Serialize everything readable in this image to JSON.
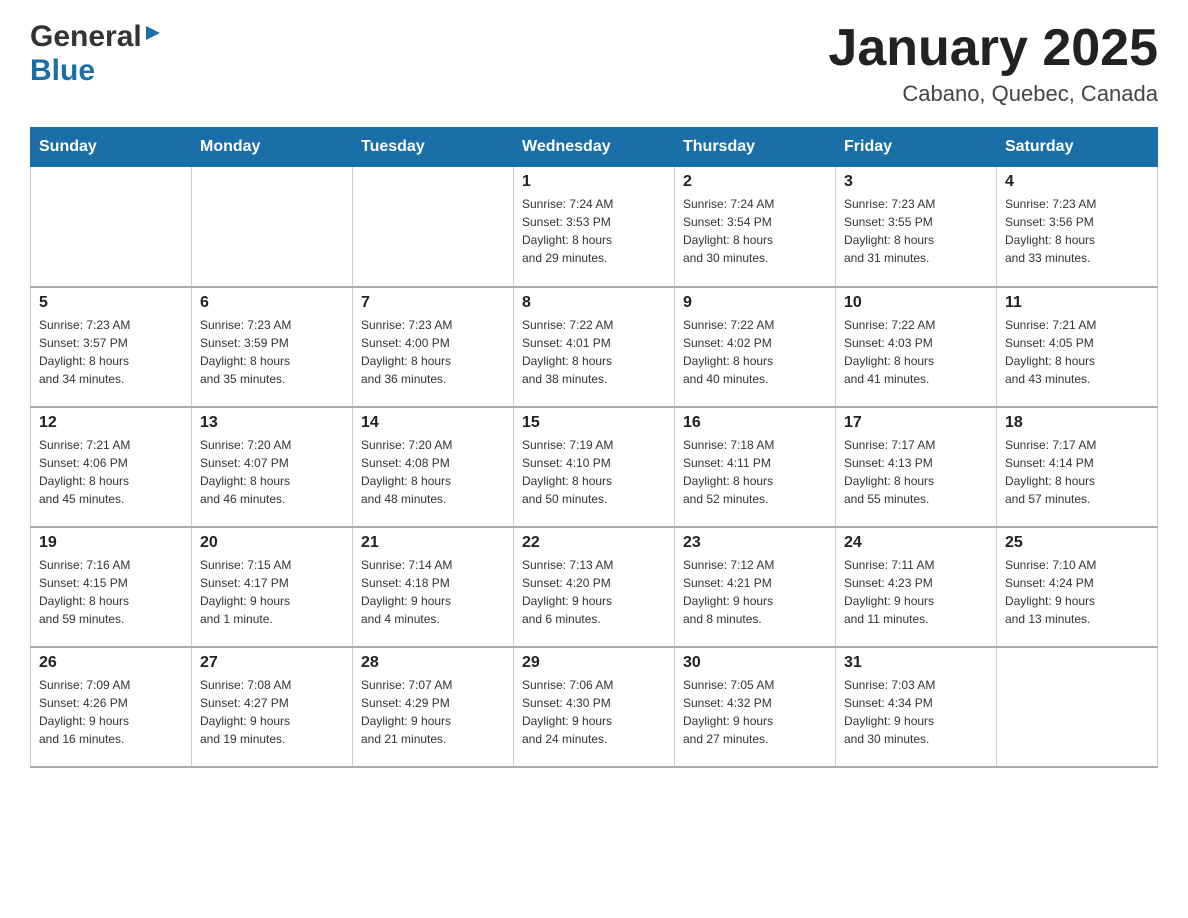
{
  "header": {
    "logo_general": "General",
    "logo_blue": "Blue",
    "month_title": "January 2025",
    "location": "Cabano, Quebec, Canada"
  },
  "days_of_week": [
    "Sunday",
    "Monday",
    "Tuesday",
    "Wednesday",
    "Thursday",
    "Friday",
    "Saturday"
  ],
  "weeks": [
    [
      {
        "day": "",
        "info": ""
      },
      {
        "day": "",
        "info": ""
      },
      {
        "day": "",
        "info": ""
      },
      {
        "day": "1",
        "info": "Sunrise: 7:24 AM\nSunset: 3:53 PM\nDaylight: 8 hours\nand 29 minutes."
      },
      {
        "day": "2",
        "info": "Sunrise: 7:24 AM\nSunset: 3:54 PM\nDaylight: 8 hours\nand 30 minutes."
      },
      {
        "day": "3",
        "info": "Sunrise: 7:23 AM\nSunset: 3:55 PM\nDaylight: 8 hours\nand 31 minutes."
      },
      {
        "day": "4",
        "info": "Sunrise: 7:23 AM\nSunset: 3:56 PM\nDaylight: 8 hours\nand 33 minutes."
      }
    ],
    [
      {
        "day": "5",
        "info": "Sunrise: 7:23 AM\nSunset: 3:57 PM\nDaylight: 8 hours\nand 34 minutes."
      },
      {
        "day": "6",
        "info": "Sunrise: 7:23 AM\nSunset: 3:59 PM\nDaylight: 8 hours\nand 35 minutes."
      },
      {
        "day": "7",
        "info": "Sunrise: 7:23 AM\nSunset: 4:00 PM\nDaylight: 8 hours\nand 36 minutes."
      },
      {
        "day": "8",
        "info": "Sunrise: 7:22 AM\nSunset: 4:01 PM\nDaylight: 8 hours\nand 38 minutes."
      },
      {
        "day": "9",
        "info": "Sunrise: 7:22 AM\nSunset: 4:02 PM\nDaylight: 8 hours\nand 40 minutes."
      },
      {
        "day": "10",
        "info": "Sunrise: 7:22 AM\nSunset: 4:03 PM\nDaylight: 8 hours\nand 41 minutes."
      },
      {
        "day": "11",
        "info": "Sunrise: 7:21 AM\nSunset: 4:05 PM\nDaylight: 8 hours\nand 43 minutes."
      }
    ],
    [
      {
        "day": "12",
        "info": "Sunrise: 7:21 AM\nSunset: 4:06 PM\nDaylight: 8 hours\nand 45 minutes."
      },
      {
        "day": "13",
        "info": "Sunrise: 7:20 AM\nSunset: 4:07 PM\nDaylight: 8 hours\nand 46 minutes."
      },
      {
        "day": "14",
        "info": "Sunrise: 7:20 AM\nSunset: 4:08 PM\nDaylight: 8 hours\nand 48 minutes."
      },
      {
        "day": "15",
        "info": "Sunrise: 7:19 AM\nSunset: 4:10 PM\nDaylight: 8 hours\nand 50 minutes."
      },
      {
        "day": "16",
        "info": "Sunrise: 7:18 AM\nSunset: 4:11 PM\nDaylight: 8 hours\nand 52 minutes."
      },
      {
        "day": "17",
        "info": "Sunrise: 7:17 AM\nSunset: 4:13 PM\nDaylight: 8 hours\nand 55 minutes."
      },
      {
        "day": "18",
        "info": "Sunrise: 7:17 AM\nSunset: 4:14 PM\nDaylight: 8 hours\nand 57 minutes."
      }
    ],
    [
      {
        "day": "19",
        "info": "Sunrise: 7:16 AM\nSunset: 4:15 PM\nDaylight: 8 hours\nand 59 minutes."
      },
      {
        "day": "20",
        "info": "Sunrise: 7:15 AM\nSunset: 4:17 PM\nDaylight: 9 hours\nand 1 minute."
      },
      {
        "day": "21",
        "info": "Sunrise: 7:14 AM\nSunset: 4:18 PM\nDaylight: 9 hours\nand 4 minutes."
      },
      {
        "day": "22",
        "info": "Sunrise: 7:13 AM\nSunset: 4:20 PM\nDaylight: 9 hours\nand 6 minutes."
      },
      {
        "day": "23",
        "info": "Sunrise: 7:12 AM\nSunset: 4:21 PM\nDaylight: 9 hours\nand 8 minutes."
      },
      {
        "day": "24",
        "info": "Sunrise: 7:11 AM\nSunset: 4:23 PM\nDaylight: 9 hours\nand 11 minutes."
      },
      {
        "day": "25",
        "info": "Sunrise: 7:10 AM\nSunset: 4:24 PM\nDaylight: 9 hours\nand 13 minutes."
      }
    ],
    [
      {
        "day": "26",
        "info": "Sunrise: 7:09 AM\nSunset: 4:26 PM\nDaylight: 9 hours\nand 16 minutes."
      },
      {
        "day": "27",
        "info": "Sunrise: 7:08 AM\nSunset: 4:27 PM\nDaylight: 9 hours\nand 19 minutes."
      },
      {
        "day": "28",
        "info": "Sunrise: 7:07 AM\nSunset: 4:29 PM\nDaylight: 9 hours\nand 21 minutes."
      },
      {
        "day": "29",
        "info": "Sunrise: 7:06 AM\nSunset: 4:30 PM\nDaylight: 9 hours\nand 24 minutes."
      },
      {
        "day": "30",
        "info": "Sunrise: 7:05 AM\nSunset: 4:32 PM\nDaylight: 9 hours\nand 27 minutes."
      },
      {
        "day": "31",
        "info": "Sunrise: 7:03 AM\nSunset: 4:34 PM\nDaylight: 9 hours\nand 30 minutes."
      },
      {
        "day": "",
        "info": ""
      }
    ]
  ]
}
